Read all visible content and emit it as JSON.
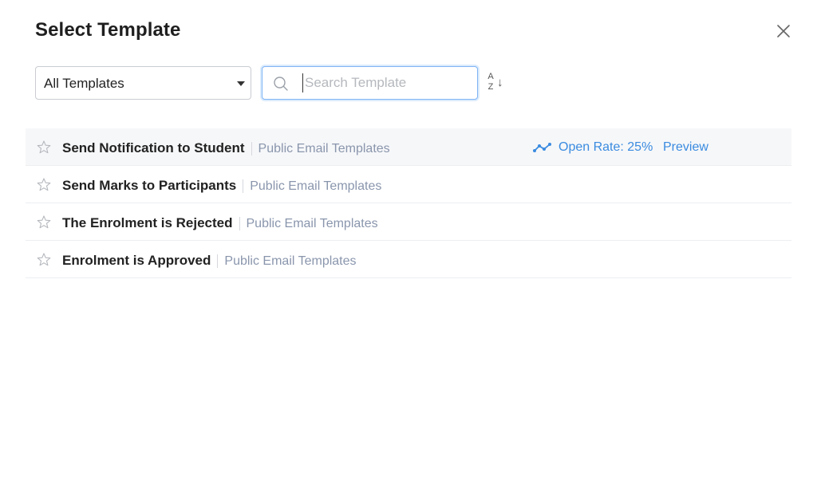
{
  "dialog": {
    "title": "Select Template"
  },
  "filter": {
    "selected": "All Templates"
  },
  "search": {
    "placeholder": "Search Template",
    "value": ""
  },
  "sort": {
    "top_letter": "A",
    "bottom_letter": "Z",
    "arrow": "↓"
  },
  "templates": [
    {
      "name": "Send Notification to Student",
      "category": "Public Email Templates",
      "open_rate": "Open Rate: 25%",
      "preview": "Preview"
    },
    {
      "name": "Send Marks to Participants",
      "category": "Public Email Templates"
    },
    {
      "name": "The Enrolment is Rejected",
      "category": "Public Email Templates"
    },
    {
      "name": "Enrolment is Approved",
      "category": "Public Email Templates"
    }
  ],
  "colors": {
    "accent": "#3a8be0",
    "category_text": "#8a96ad",
    "hover_row": "#f6f7f9"
  },
  "icons": {
    "close": "close-icon",
    "search": "search-icon",
    "star": "star-outline-icon",
    "trend": "trend-line-icon",
    "caret": "caret-down-icon"
  }
}
